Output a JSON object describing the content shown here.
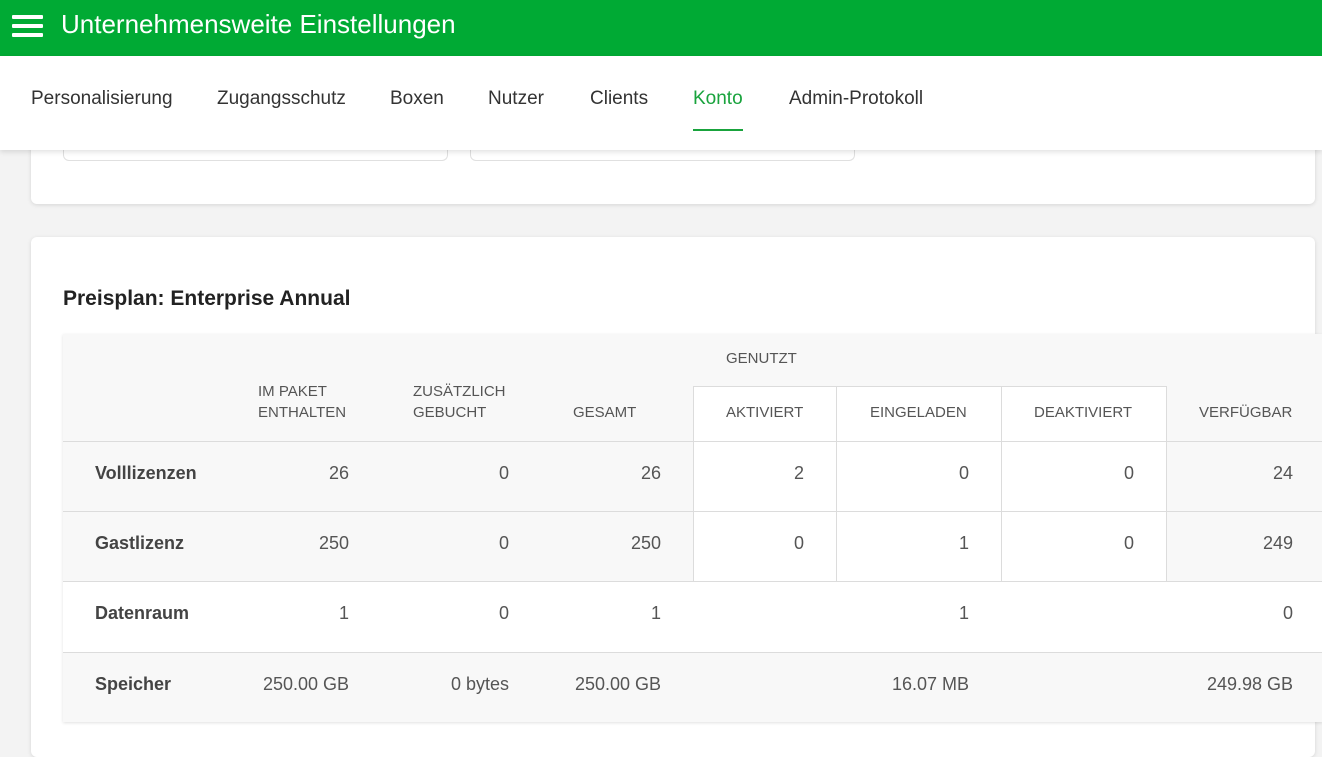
{
  "header": {
    "title": "Unternehmensweite Einstellungen"
  },
  "tabs": [
    {
      "label": "Personalisierung"
    },
    {
      "label": "Zugangsschutz"
    },
    {
      "label": "Boxen"
    },
    {
      "label": "Nutzer"
    },
    {
      "label": "Clients"
    },
    {
      "label": "Konto",
      "active": true
    },
    {
      "label": "Admin-Protokoll"
    }
  ],
  "plan": {
    "title": "Preisplan: Enterprise Annual",
    "headers": {
      "included": [
        "IM PAKET",
        "ENTHALTEN"
      ],
      "additional": [
        "ZUSÄTZLICH",
        "GEBUCHT"
      ],
      "total": "GESAMT",
      "used_group": "GENUTZT",
      "activated": "AKTIVIERT",
      "invited": "EINGELADEN",
      "deactivated": "DEAKTIVIERT",
      "available": "VERFÜGBAR"
    },
    "rows": [
      {
        "label": "Volllizenzen",
        "included": "26",
        "additional": "0",
        "total": "26",
        "activated": "2",
        "invited": "0",
        "deactivated": "0",
        "available": "24"
      },
      {
        "label": "Gastlizenz",
        "included": "250",
        "additional": "0",
        "total": "250",
        "activated": "0",
        "invited": "1",
        "deactivated": "0",
        "available": "249"
      },
      {
        "label": "Datenraum",
        "included": "1",
        "additional": "0",
        "total": "1",
        "used": "1",
        "available": "0"
      },
      {
        "label": "Speicher",
        "included": "250.00 GB",
        "additional": "0 bytes",
        "total": "250.00 GB",
        "used": "16.07 MB",
        "available": "249.98 GB"
      }
    ]
  },
  "colors": {
    "brand": "#00aa34",
    "active_tab": "#19a33d"
  },
  "icons": {
    "menu": "hamburger-menu-icon"
  }
}
